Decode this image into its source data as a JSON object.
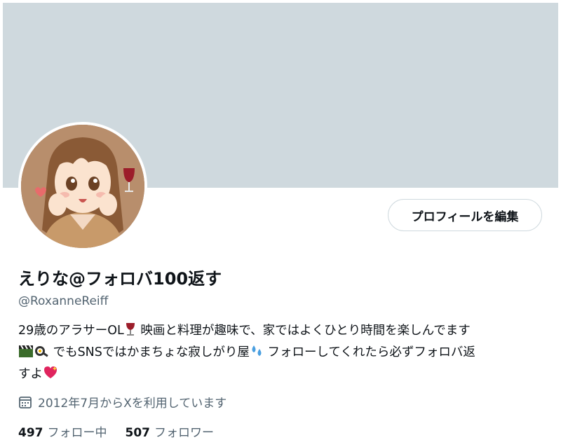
{
  "profile": {
    "display_name": "えりな@フォロバ100返す",
    "handle": "@RoxanneReiff",
    "edit_profile_label": "プロフィールを編集",
    "bio": {
      "line1_text": "29歳のアラサーOL",
      "line1_after": " 映画と料理が趣味で、家ではよくひとり時間を楽しんでます",
      "line2_after": " でもSNSではかまちょな寂しがり屋",
      "line2_tail": " フォローしてくれたら必ずフォロバ返",
      "line3_text": "すよ"
    },
    "joined": "2012年7月からXを利用しています",
    "following_count": "497",
    "following_label": "フォロー中",
    "followers_count": "507",
    "followers_label": "フォロワー"
  },
  "icons": {
    "bio_emoji_1": "wine-glass-icon",
    "bio_emoji_2": "clapperboard-icon",
    "bio_emoji_3": "frying-pan-icon",
    "bio_emoji_4": "sweat-droplets-icon",
    "bio_emoji_5": "sparkling-heart-icon",
    "joined": "calendar-icon"
  },
  "colors": {
    "banner": "#cfd9de",
    "text_primary": "#0f1419",
    "text_secondary": "#536471",
    "button_border": "#cfd9de"
  }
}
